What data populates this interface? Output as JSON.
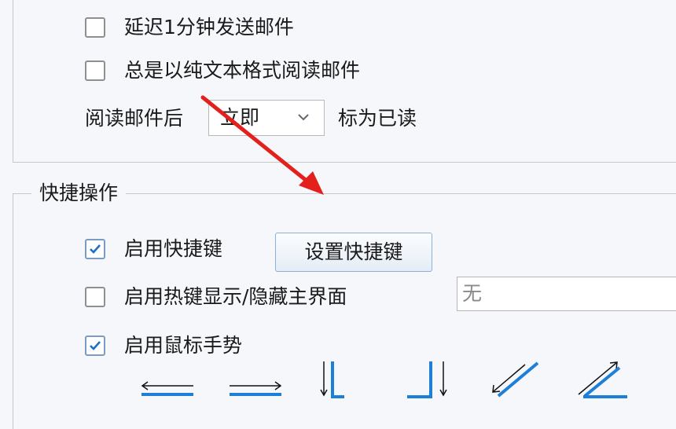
{
  "mail_options": {
    "delay_send": {
      "label": "延迟1分钟发送邮件",
      "checked": false
    },
    "plain_text": {
      "label": "总是以纯文本格式阅读邮件",
      "checked": false
    },
    "after_read_prefix": "阅读邮件后",
    "after_read_select": "立即",
    "after_read_suffix": "标为已读"
  },
  "shortcuts": {
    "title": "快捷操作",
    "enable_shortcuts": {
      "label": "启用快捷键",
      "checked": true
    },
    "set_shortcuts_button": "设置快捷键",
    "hotkey_toggle": {
      "label": "启用热键显示/隐藏主界面",
      "checked": false
    },
    "hotkey_value": "无",
    "mouse_gestures": {
      "label": "启用鼠标手势",
      "checked": true
    }
  },
  "colors": {
    "accent": "#1e7fd6",
    "annotation_arrow": "#e3201b",
    "checkmark": "#1e6fc6"
  },
  "icons": {
    "gesture_left": "arrow-left-icon",
    "gesture_right": "arrow-right-icon",
    "gesture_down_right": "down-right-icon",
    "gesture_down_left": "down-left-icon",
    "gesture_diagonal_up": "diagonal-up-icon",
    "gesture_diagonal_down": "diagonal-down-icon"
  }
}
